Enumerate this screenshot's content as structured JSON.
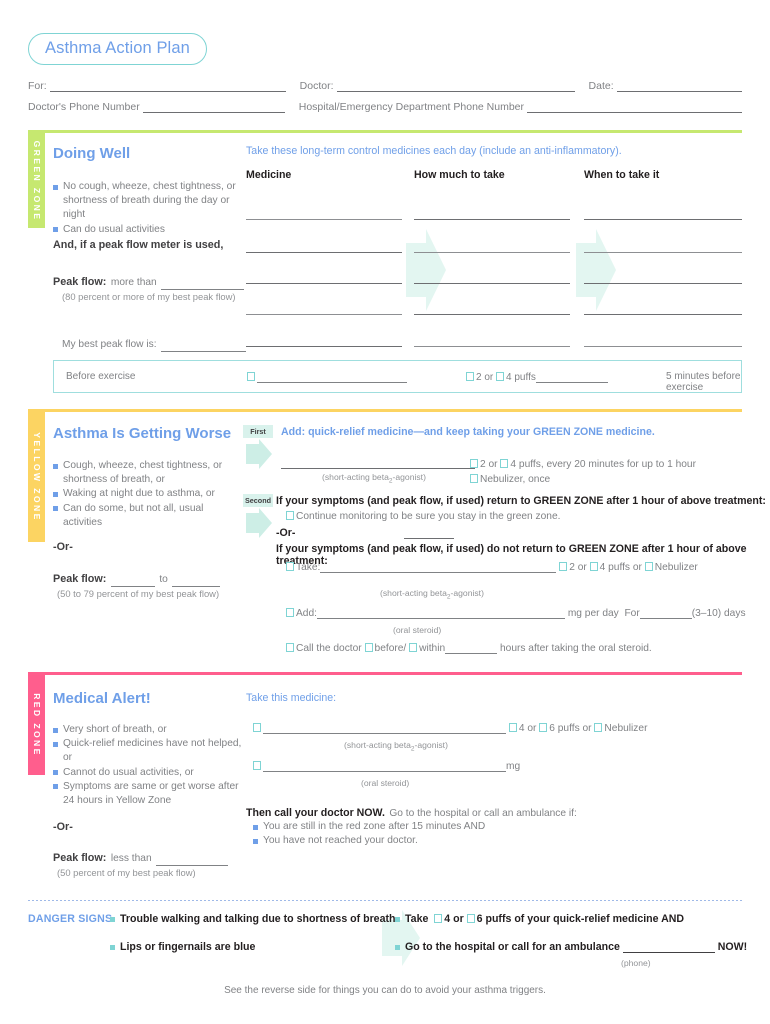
{
  "document": {
    "title": "Asthma Action Plan",
    "footer_note": "See the reverse side for things you can do to avoid your asthma triggers."
  },
  "header": {
    "for_label": "For:",
    "doctor_label": "Doctor:",
    "date_label": "Date:",
    "doctor_phone_label": "Doctor's Phone Number",
    "hospital_phone_label": "Hospital/Emergency Department Phone Number"
  },
  "green_zone": {
    "zone_label": "GREEN ZONE",
    "zone_color": "#c6e870",
    "title": "Doing Well",
    "symptoms": [
      "No cough, wheeze, chest tightness, or",
      "Can do usual activities"
    ],
    "symptom_cont": "shortness of breath during the day or night",
    "peak_flow_heading": "And, if a peak flow meter is used,",
    "peak_flow_label": "Peak flow:",
    "peak_flow_text": "more than",
    "peak_flow_note": "(80 percent or more of my best peak flow)",
    "best_peak_flow_label": "My best peak flow is:",
    "instruction": "Take these long-term control medicines each day (include an anti-inflammatory).",
    "columns": [
      "Medicine",
      "How much to take",
      "When to take it"
    ],
    "exercise": {
      "label": "Before exercise",
      "dose_2": "2",
      "or": "or",
      "dose_4": "4 puffs",
      "timing": "5 minutes before exercise"
    }
  },
  "yellow_zone": {
    "zone_label": "YELLOW ZONE",
    "zone_color": "#fcd462",
    "title": "Asthma Is Getting Worse",
    "symptoms": [
      "Cough, wheeze, chest tightness, or",
      "Waking at night due to asthma, or",
      "Can do some, but not all, usual activities"
    ],
    "symptom_cont": "shortness of breath, or",
    "or_divider": "-Or-",
    "peak_flow_label": "Peak flow:",
    "peak_flow_to": "to",
    "peak_flow_note": "(50 to 79 percent of my best peak flow)",
    "step_first": "First",
    "step_second": "Second",
    "first_instruction": "Add: quick-relief medicine—and keep taking your GREEN ZONE medicine.",
    "short_acting_note": "(short-acting beta2-agonist)",
    "oral_steroid_note": "(oral steroid)",
    "first_dose_line": "2  or  4 puffs, every 20 minutes for up to 1 hour",
    "first_dose_2": "2",
    "first_dose_or": "or",
    "first_dose_4": "4 puffs, every 20 minutes for up to 1 hour",
    "nebulizer_once": "Nebulizer, once",
    "second_return_bold": "If your symptoms (and peak flow, if used) return to GREEN ZONE after 1 hour of above treatment:",
    "second_return_check": "Continue monitoring to be sure you stay in the green zone.",
    "second_or": "-Or-",
    "second_notreturn_bold": "If your symptoms (and peak flow, if used) do not return to GREEN ZONE after 1 hour of above treatment:",
    "take_label": "Take:",
    "take_dose_2": "2",
    "take_or1": "or",
    "take_dose_4": "4 puffs",
    "take_or2": "or",
    "take_nebulizer": "Nebulizer",
    "add_label": "Add:",
    "mg_per_day": "mg per day",
    "for_label": "For",
    "days_note": "(3–10) days",
    "call_doctor": "Call the doctor",
    "before_label": "before/",
    "within_label": "within",
    "hours_after": "hours after taking the oral steroid."
  },
  "red_zone": {
    "zone_label": "RED ZONE",
    "zone_color": "#ff5e8d",
    "title": "Medical Alert!",
    "symptoms": [
      "Very short of breath, or",
      "Quick-relief medicines have not helped, or",
      "Cannot do usual activities, or",
      "Symptoms are same or get worse after"
    ],
    "symptom_cont": "24 hours in Yellow Zone",
    "or_divider": "-Or-",
    "peak_flow_label": "Peak flow:",
    "peak_flow_text": "less than",
    "peak_flow_note": "(50 percent of my best peak flow)",
    "instruction": "Take this medicine:",
    "short_acting_note": "(short-acting beta2-agonist)",
    "oral_steroid_note": "(oral steroid)",
    "dose_4": "4",
    "dose_or1": "or",
    "dose_6": "6 puffs",
    "dose_or2": "or",
    "dose_nebulizer": "Nebulizer",
    "mg_label": "mg",
    "call_bold": "Then call your doctor NOW.",
    "call_rest": "Go to the hospital or call an ambulance if:",
    "call_bullets": [
      "You are still in the red zone after 15 minutes AND",
      "You have not reached your doctor."
    ]
  },
  "danger_signs": {
    "label": "DANGER SIGNS",
    "left_items": [
      "Trouble walking and talking due to shortness of breath",
      "Lips or fingernails are blue"
    ],
    "right_take_prefix": "Take",
    "right_dose_4": "4 or",
    "right_dose_6": "6 puffs of your quick-relief medicine AND",
    "right_ambulance": "Go to the hospital or call for an ambulance",
    "right_now": "NOW!",
    "phone_note": "(phone)"
  }
}
